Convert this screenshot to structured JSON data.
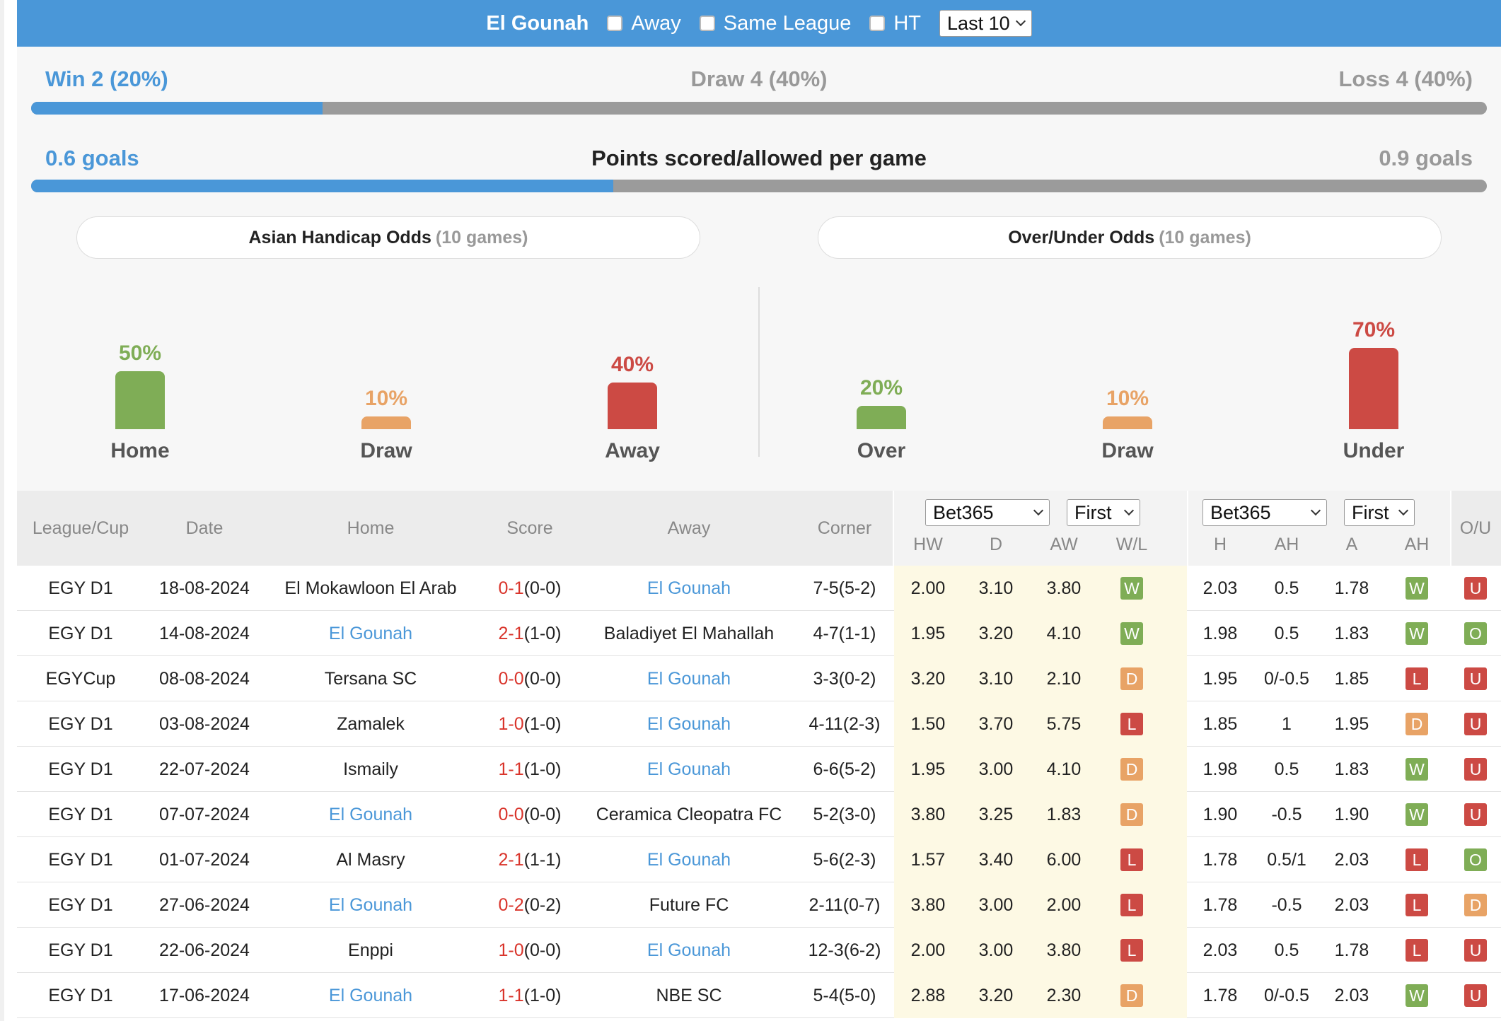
{
  "header": {
    "team": "El Gounah",
    "options": [
      {
        "label": "Away",
        "checked": false
      },
      {
        "label": "Same League",
        "checked": false
      },
      {
        "label": "HT",
        "checked": false
      }
    ],
    "range_select": "Last 10"
  },
  "summary": {
    "win": "Win 2 (20%)",
    "draw": "Draw 4 (40%)",
    "loss": "Loss 4 (40%)",
    "win_fraction": 0.2,
    "goals_for": "0.6 goals",
    "goals_title": "Points scored/allowed per game",
    "goals_against": "0.9 goals",
    "goals_fraction": 0.4,
    "asian_handicap": {
      "title": "Asian Handicap Odds",
      "games": "(10 games)",
      "stats": [
        {
          "label": "Home",
          "pct": "50%",
          "value": 50,
          "color": "#7fad56"
        },
        {
          "label": "Draw",
          "pct": "10%",
          "value": 10,
          "color": "#e8a366"
        },
        {
          "label": "Away",
          "pct": "40%",
          "value": 40,
          "color": "#cc4a44"
        }
      ]
    },
    "over_under": {
      "title": "Over/Under Odds",
      "games": "(10 games)",
      "stats": [
        {
          "label": "Over",
          "pct": "20%",
          "value": 20,
          "color": "#7fad56"
        },
        {
          "label": "Draw",
          "pct": "10%",
          "value": 10,
          "color": "#e8a366"
        },
        {
          "label": "Under",
          "pct": "70%",
          "value": 70,
          "color": "#cc4a44"
        }
      ]
    }
  },
  "table": {
    "headers": {
      "league": "League/Cup",
      "date": "Date",
      "home": "Home",
      "score": "Score",
      "away": "Away",
      "corner": "Corner",
      "ou": "O/U"
    },
    "odds1": {
      "bookmaker": "Bet365",
      "period": "First",
      "cols": [
        "HW",
        "D",
        "AW",
        "W/L"
      ]
    },
    "odds2": {
      "bookmaker": "Bet365",
      "period": "First",
      "cols": [
        "H",
        "AH",
        "A",
        "AH"
      ]
    },
    "rows": [
      {
        "league": "EGY D1",
        "date": "18-08-2024",
        "home": "El Mokawloon El Arab",
        "home_team": false,
        "ft": "0-1",
        "ht": "(0-0)",
        "away": "El Gounah",
        "away_team": true,
        "corner": "7-5(5-2)",
        "hw": "2.00",
        "d": "3.10",
        "aw": "3.80",
        "wl": "W",
        "h": "2.03",
        "ah": "0.5",
        "a": "1.78",
        "ahr": "W",
        "ou": "U"
      },
      {
        "league": "EGY D1",
        "date": "14-08-2024",
        "home": "El Gounah",
        "home_team": true,
        "ft": "2-1",
        "ht": "(1-0)",
        "away": "Baladiyet El Mahallah",
        "away_team": false,
        "corner": "4-7(1-1)",
        "hw": "1.95",
        "d": "3.20",
        "aw": "4.10",
        "wl": "W",
        "h": "1.98",
        "ah": "0.5",
        "a": "1.83",
        "ahr": "W",
        "ou": "O"
      },
      {
        "league": "EGYCup",
        "date": "08-08-2024",
        "home": "Tersana SC",
        "home_team": false,
        "ft": "0-0",
        "ht": "(0-0)",
        "away": "El Gounah",
        "away_team": true,
        "corner": "3-3(0-2)",
        "hw": "3.20",
        "d": "3.10",
        "aw": "2.10",
        "wl": "D",
        "h": "1.95",
        "ah": "0/-0.5",
        "a": "1.85",
        "ahr": "L",
        "ou": "U"
      },
      {
        "league": "EGY D1",
        "date": "03-08-2024",
        "home": "Zamalek",
        "home_team": false,
        "ft": "1-0",
        "ht": "(1-0)",
        "away": "El Gounah",
        "away_team": true,
        "corner": "4-11(2-3)",
        "hw": "1.50",
        "d": "3.70",
        "aw": "5.75",
        "wl": "L",
        "h": "1.85",
        "ah": "1",
        "a": "1.95",
        "ahr": "D",
        "ou": "U"
      },
      {
        "league": "EGY D1",
        "date": "22-07-2024",
        "home": "Ismaily",
        "home_team": false,
        "ft": "1-1",
        "ht": "(1-0)",
        "away": "El Gounah",
        "away_team": true,
        "corner": "6-6(5-2)",
        "hw": "1.95",
        "d": "3.00",
        "aw": "4.10",
        "wl": "D",
        "h": "1.98",
        "ah": "0.5",
        "a": "1.83",
        "ahr": "W",
        "ou": "U"
      },
      {
        "league": "EGY D1",
        "date": "07-07-2024",
        "home": "El Gounah",
        "home_team": true,
        "ft": "0-0",
        "ht": "(0-0)",
        "away": "Ceramica Cleopatra FC",
        "away_team": false,
        "corner": "5-2(3-0)",
        "hw": "3.80",
        "d": "3.25",
        "aw": "1.83",
        "wl": "D",
        "h": "1.90",
        "ah": "-0.5",
        "a": "1.90",
        "ahr": "W",
        "ou": "U"
      },
      {
        "league": "EGY D1",
        "date": "01-07-2024",
        "home": "Al Masry",
        "home_team": false,
        "ft": "2-1",
        "ht": "(1-1)",
        "away": "El Gounah",
        "away_team": true,
        "corner": "5-6(2-3)",
        "hw": "1.57",
        "d": "3.40",
        "aw": "6.00",
        "wl": "L",
        "h": "1.78",
        "ah": "0.5/1",
        "a": "2.03",
        "ahr": "L",
        "ou": "O"
      },
      {
        "league": "EGY D1",
        "date": "27-06-2024",
        "home": "El Gounah",
        "home_team": true,
        "ft": "0-2",
        "ht": "(0-2)",
        "away": "Future FC",
        "away_team": false,
        "corner": "2-11(0-7)",
        "hw": "3.80",
        "d": "3.00",
        "aw": "2.00",
        "wl": "L",
        "h": "1.78",
        "ah": "-0.5",
        "a": "2.03",
        "ahr": "L",
        "ou": "D"
      },
      {
        "league": "EGY D1",
        "date": "22-06-2024",
        "home": "Enppi",
        "home_team": false,
        "ft": "1-0",
        "ht": "(0-0)",
        "away": "El Gounah",
        "away_team": true,
        "corner": "12-3(6-2)",
        "hw": "2.00",
        "d": "3.00",
        "aw": "3.80",
        "wl": "L",
        "h": "2.03",
        "ah": "0.5",
        "a": "1.78",
        "ahr": "L",
        "ou": "U"
      },
      {
        "league": "EGY D1",
        "date": "17-06-2024",
        "home": "El Gounah",
        "home_team": true,
        "ft": "1-1",
        "ht": "(1-0)",
        "away": "NBE SC",
        "away_team": false,
        "corner": "5-4(5-0)",
        "hw": "2.88",
        "d": "3.20",
        "aw": "2.30",
        "wl": "D",
        "h": "1.78",
        "ah": "0/-0.5",
        "a": "2.03",
        "ahr": "W",
        "ou": "U"
      }
    ]
  },
  "colors": {
    "brand": "#4a97d8",
    "win": "#7fad56",
    "draw": "#e8a366",
    "loss": "#cc4a44",
    "W": "#7fad56",
    "D": "#e8a366",
    "L": "#cc4a44",
    "O": "#7fad56",
    "U": "#cc4a44"
  }
}
